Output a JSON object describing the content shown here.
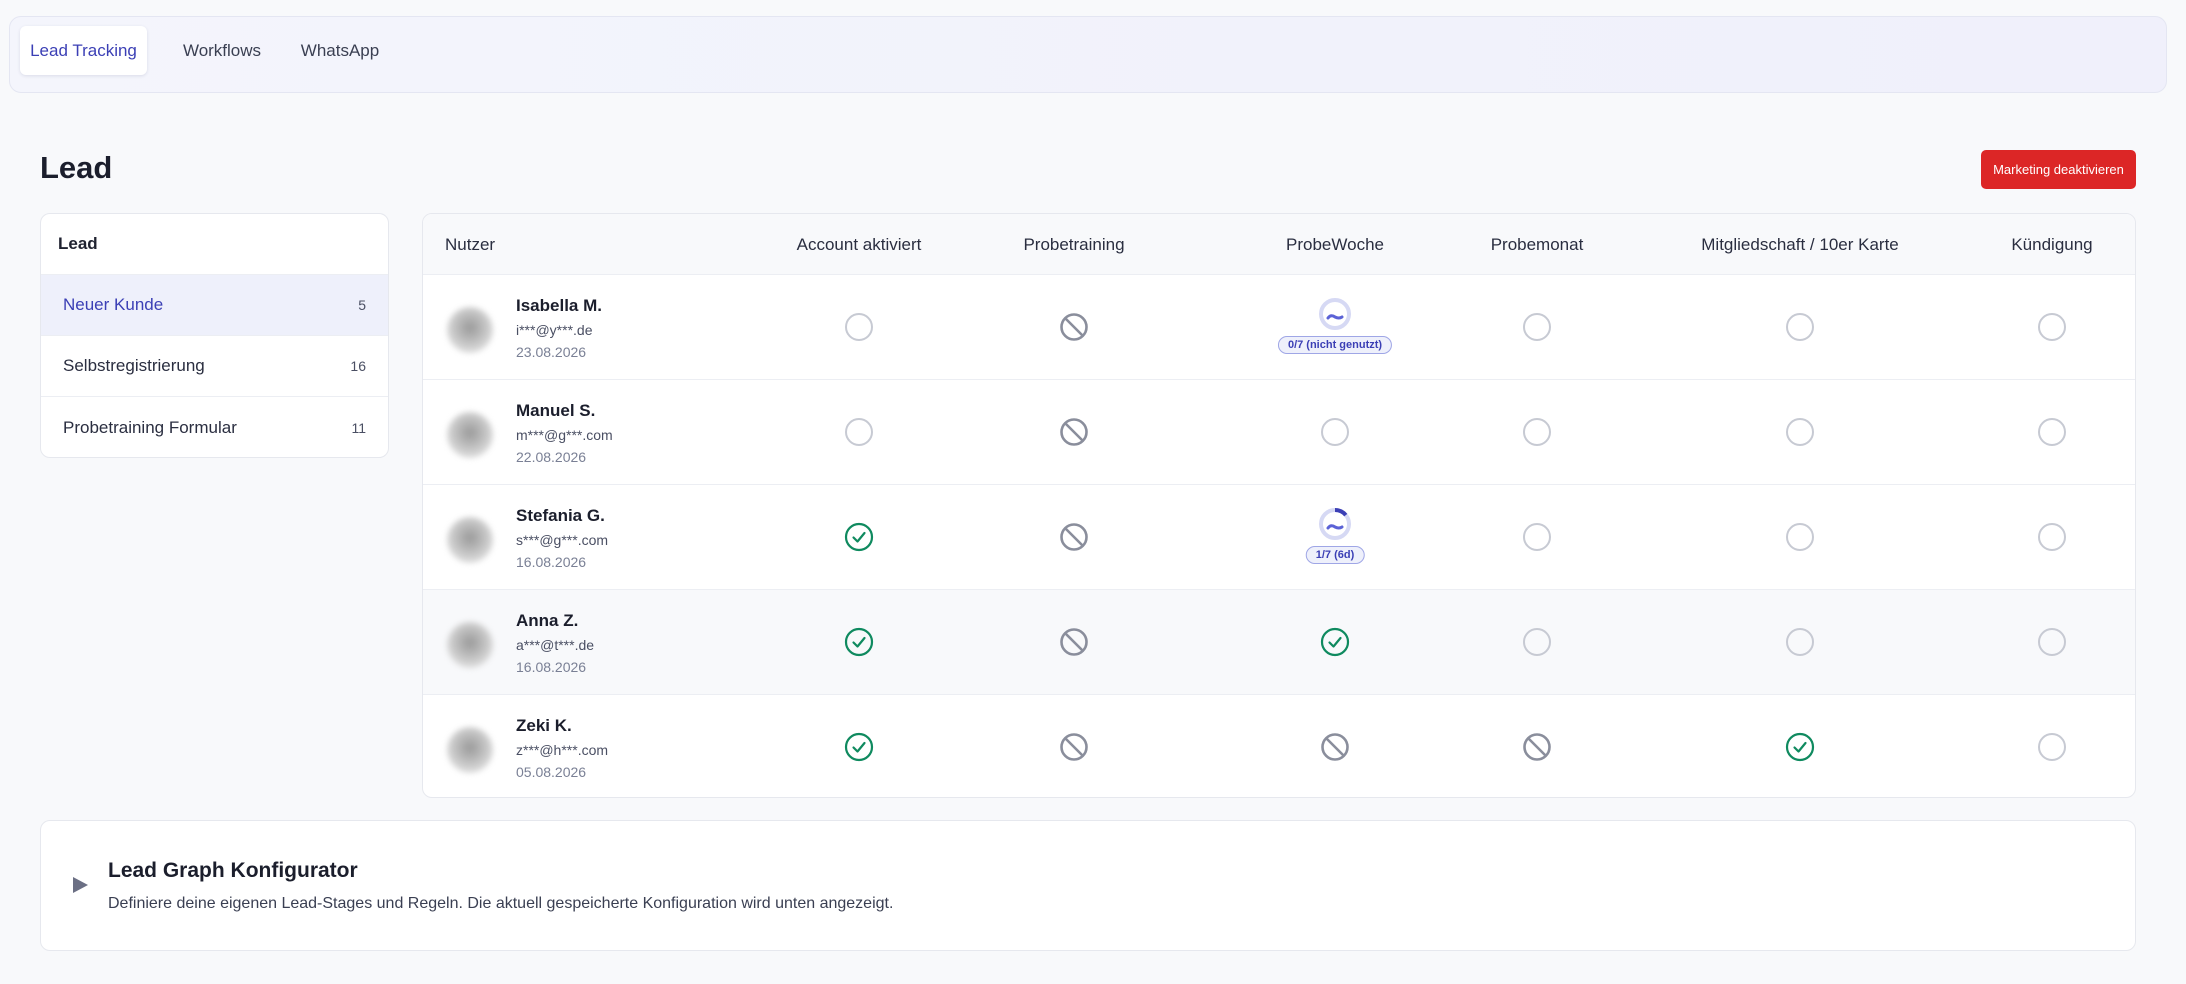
{
  "tabs": [
    {
      "label": "Lead Tracking",
      "active": true
    },
    {
      "label": "Workflows",
      "active": false
    },
    {
      "label": "WhatsApp",
      "active": false
    }
  ],
  "page": {
    "title": "Lead",
    "marketing_button": "Marketing deaktivieren"
  },
  "sidebar": {
    "title": "Lead",
    "items": [
      {
        "label": "Neuer Kunde",
        "count": "5",
        "active": true
      },
      {
        "label": "Selbstregistrierung",
        "count": "16",
        "active": false
      },
      {
        "label": "Probetraining Formular",
        "count": "11",
        "active": false
      }
    ]
  },
  "table": {
    "columns": [
      "Nutzer",
      "Account aktiviert",
      "Probetraining",
      "ProbeWoche",
      "Probemonat",
      "Mitgliedschaft / 10er Karte",
      "Kündigung"
    ],
    "rows": [
      {
        "name": "Isabella M.",
        "email": "i***@y***.de",
        "date": "23.08.2026",
        "status": [
          "empty",
          "blocked",
          "progress",
          "empty",
          "empty",
          "empty"
        ],
        "progress_label": "0/7 (nicht genutzt)",
        "progress_value": 0.0
      },
      {
        "name": "Manuel S.",
        "email": "m***@g***.com",
        "date": "22.08.2026",
        "status": [
          "empty",
          "blocked",
          "empty",
          "empty",
          "empty",
          "empty"
        ]
      },
      {
        "name": "Stefania G.",
        "email": "s***@g***.com",
        "date": "16.08.2026",
        "status": [
          "check",
          "blocked",
          "progress",
          "empty",
          "empty",
          "empty"
        ],
        "progress_label": "1/7 (6d)",
        "progress_value": 0.14
      },
      {
        "name": "Anna Z.",
        "email": "a***@t***.de",
        "date": "16.08.2026",
        "status": [
          "check",
          "blocked",
          "check",
          "empty",
          "empty",
          "empty"
        ]
      },
      {
        "name": "Zeki K.",
        "email": "z***@h***.com",
        "date": "05.08.2026",
        "status": [
          "check",
          "blocked",
          "blocked",
          "blocked",
          "check",
          "empty"
        ]
      }
    ]
  },
  "configurator": {
    "title": "Lead Graph Konfigurator",
    "description": "Definiere deine eigenen Lead-Stages und Regeln. Die aktuell gespeicherte Konfiguration wird unten angezeigt."
  },
  "colors": {
    "accent": "#3b3fb5",
    "danger": "#dc2626",
    "success": "#0f8a5f",
    "muted": "#c7cad3"
  }
}
